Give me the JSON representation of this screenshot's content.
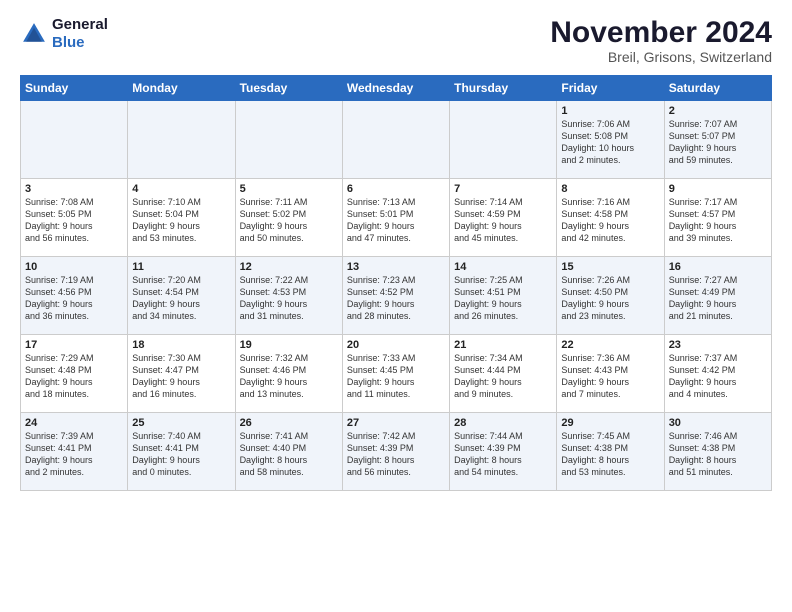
{
  "header": {
    "logo_general": "General",
    "logo_blue": "Blue",
    "month_year": "November 2024",
    "location": "Breil, Grisons, Switzerland"
  },
  "weekdays": [
    "Sunday",
    "Monday",
    "Tuesday",
    "Wednesday",
    "Thursday",
    "Friday",
    "Saturday"
  ],
  "rows": [
    [
      {
        "day": "",
        "info": ""
      },
      {
        "day": "",
        "info": ""
      },
      {
        "day": "",
        "info": ""
      },
      {
        "day": "",
        "info": ""
      },
      {
        "day": "",
        "info": ""
      },
      {
        "day": "1",
        "info": "Sunrise: 7:06 AM\nSunset: 5:08 PM\nDaylight: 10 hours\nand 2 minutes."
      },
      {
        "day": "2",
        "info": "Sunrise: 7:07 AM\nSunset: 5:07 PM\nDaylight: 9 hours\nand 59 minutes."
      }
    ],
    [
      {
        "day": "3",
        "info": "Sunrise: 7:08 AM\nSunset: 5:05 PM\nDaylight: 9 hours\nand 56 minutes."
      },
      {
        "day": "4",
        "info": "Sunrise: 7:10 AM\nSunset: 5:04 PM\nDaylight: 9 hours\nand 53 minutes."
      },
      {
        "day": "5",
        "info": "Sunrise: 7:11 AM\nSunset: 5:02 PM\nDaylight: 9 hours\nand 50 minutes."
      },
      {
        "day": "6",
        "info": "Sunrise: 7:13 AM\nSunset: 5:01 PM\nDaylight: 9 hours\nand 47 minutes."
      },
      {
        "day": "7",
        "info": "Sunrise: 7:14 AM\nSunset: 4:59 PM\nDaylight: 9 hours\nand 45 minutes."
      },
      {
        "day": "8",
        "info": "Sunrise: 7:16 AM\nSunset: 4:58 PM\nDaylight: 9 hours\nand 42 minutes."
      },
      {
        "day": "9",
        "info": "Sunrise: 7:17 AM\nSunset: 4:57 PM\nDaylight: 9 hours\nand 39 minutes."
      }
    ],
    [
      {
        "day": "10",
        "info": "Sunrise: 7:19 AM\nSunset: 4:56 PM\nDaylight: 9 hours\nand 36 minutes."
      },
      {
        "day": "11",
        "info": "Sunrise: 7:20 AM\nSunset: 4:54 PM\nDaylight: 9 hours\nand 34 minutes."
      },
      {
        "day": "12",
        "info": "Sunrise: 7:22 AM\nSunset: 4:53 PM\nDaylight: 9 hours\nand 31 minutes."
      },
      {
        "day": "13",
        "info": "Sunrise: 7:23 AM\nSunset: 4:52 PM\nDaylight: 9 hours\nand 28 minutes."
      },
      {
        "day": "14",
        "info": "Sunrise: 7:25 AM\nSunset: 4:51 PM\nDaylight: 9 hours\nand 26 minutes."
      },
      {
        "day": "15",
        "info": "Sunrise: 7:26 AM\nSunset: 4:50 PM\nDaylight: 9 hours\nand 23 minutes."
      },
      {
        "day": "16",
        "info": "Sunrise: 7:27 AM\nSunset: 4:49 PM\nDaylight: 9 hours\nand 21 minutes."
      }
    ],
    [
      {
        "day": "17",
        "info": "Sunrise: 7:29 AM\nSunset: 4:48 PM\nDaylight: 9 hours\nand 18 minutes."
      },
      {
        "day": "18",
        "info": "Sunrise: 7:30 AM\nSunset: 4:47 PM\nDaylight: 9 hours\nand 16 minutes."
      },
      {
        "day": "19",
        "info": "Sunrise: 7:32 AM\nSunset: 4:46 PM\nDaylight: 9 hours\nand 13 minutes."
      },
      {
        "day": "20",
        "info": "Sunrise: 7:33 AM\nSunset: 4:45 PM\nDaylight: 9 hours\nand 11 minutes."
      },
      {
        "day": "21",
        "info": "Sunrise: 7:34 AM\nSunset: 4:44 PM\nDaylight: 9 hours\nand 9 minutes."
      },
      {
        "day": "22",
        "info": "Sunrise: 7:36 AM\nSunset: 4:43 PM\nDaylight: 9 hours\nand 7 minutes."
      },
      {
        "day": "23",
        "info": "Sunrise: 7:37 AM\nSunset: 4:42 PM\nDaylight: 9 hours\nand 4 minutes."
      }
    ],
    [
      {
        "day": "24",
        "info": "Sunrise: 7:39 AM\nSunset: 4:41 PM\nDaylight: 9 hours\nand 2 minutes."
      },
      {
        "day": "25",
        "info": "Sunrise: 7:40 AM\nSunset: 4:41 PM\nDaylight: 9 hours\nand 0 minutes."
      },
      {
        "day": "26",
        "info": "Sunrise: 7:41 AM\nSunset: 4:40 PM\nDaylight: 8 hours\nand 58 minutes."
      },
      {
        "day": "27",
        "info": "Sunrise: 7:42 AM\nSunset: 4:39 PM\nDaylight: 8 hours\nand 56 minutes."
      },
      {
        "day": "28",
        "info": "Sunrise: 7:44 AM\nSunset: 4:39 PM\nDaylight: 8 hours\nand 54 minutes."
      },
      {
        "day": "29",
        "info": "Sunrise: 7:45 AM\nSunset: 4:38 PM\nDaylight: 8 hours\nand 53 minutes."
      },
      {
        "day": "30",
        "info": "Sunrise: 7:46 AM\nSunset: 4:38 PM\nDaylight: 8 hours\nand 51 minutes."
      }
    ]
  ]
}
